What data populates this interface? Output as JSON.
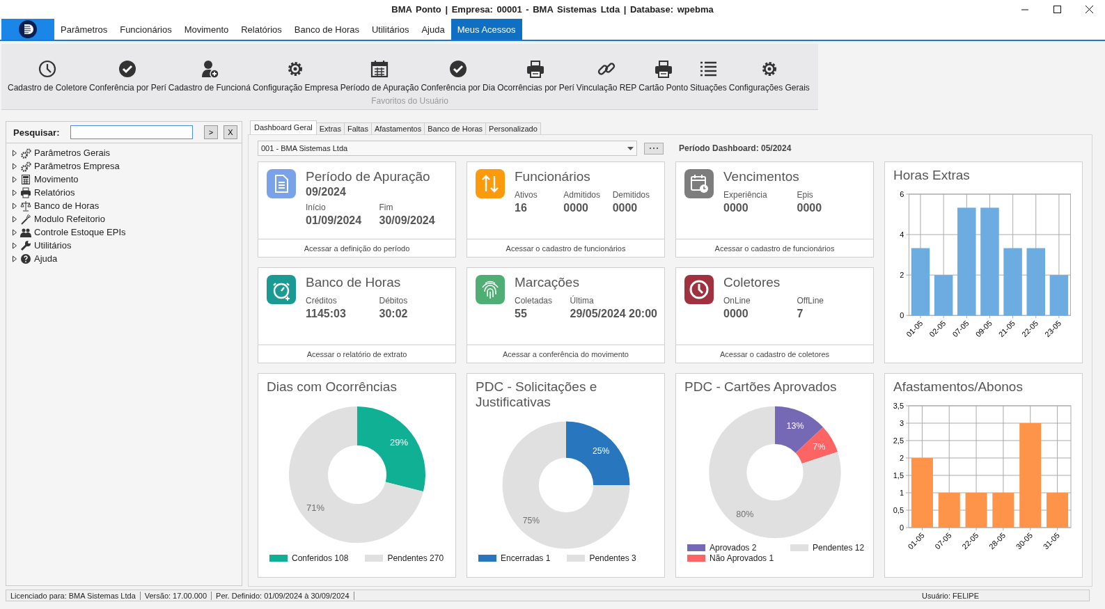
{
  "window": {
    "title": "BMA Ponto | Empresa: 00001 - BMA Sistemas Ltda | Database: wpebma"
  },
  "menu": [
    {
      "label": "Parâmetros",
      "selected": false
    },
    {
      "label": "Funcionários",
      "selected": false
    },
    {
      "label": "Movimento",
      "selected": false
    },
    {
      "label": "Relatórios",
      "selected": false
    },
    {
      "label": "Banco de Horas",
      "selected": false
    },
    {
      "label": "Utilitários",
      "selected": false
    },
    {
      "label": "Ajuda",
      "selected": false
    },
    {
      "label": "Meus Acessos",
      "selected": true
    }
  ],
  "ribbon": {
    "group_label": "Favoritos do Usuário",
    "items": [
      {
        "label": "Cadastro de Coletore",
        "kind": "clock"
      },
      {
        "label": "Conferência por Perí",
        "kind": "check"
      },
      {
        "label": "Cadastro de Funcioná",
        "kind": "user"
      },
      {
        "label": "Configuração Empresa",
        "kind": "gear"
      },
      {
        "label": "Período de Apuração",
        "kind": "calendar"
      },
      {
        "label": "Conferência por Dia",
        "kind": "check"
      },
      {
        "label": "Ocorrências por Perí",
        "kind": "printer"
      },
      {
        "label": "Vinculação REP",
        "kind": "link"
      },
      {
        "label": "Cartão Ponto",
        "kind": "printer"
      },
      {
        "label": "Situações",
        "kind": "list"
      },
      {
        "label": "Configurações Gerais",
        "kind": "gear"
      }
    ]
  },
  "search": {
    "label": "Pesquisar:",
    "buttons": [
      ">",
      "X"
    ]
  },
  "tree": [
    {
      "label": "Parâmetros Gerais",
      "kind": "gears",
      "expanded": false
    },
    {
      "label": "Parâmetros Empresa",
      "kind": "gears",
      "expanded": false
    },
    {
      "label": "Movimento",
      "kind": "calculator",
      "expanded": false
    },
    {
      "label": "Relatórios",
      "kind": "printer",
      "expanded": false
    },
    {
      "label": "Banco de Horas",
      "kind": "scale",
      "expanded": false
    },
    {
      "label": "Modulo Refeitorio",
      "kind": "fork",
      "expanded": false
    },
    {
      "label": "Controle Estoque EPIs",
      "kind": "people",
      "expanded": false
    },
    {
      "label": "Utilitários",
      "kind": "wrench",
      "expanded": false
    },
    {
      "label": "Ajuda",
      "kind": "help",
      "expanded": false
    }
  ],
  "tabs": [
    {
      "label": "Dashboard Geral",
      "selected": true
    },
    {
      "label": "Extras",
      "selected": false
    },
    {
      "label": "Faltas",
      "selected": false
    },
    {
      "label": "Afastamentos",
      "selected": false
    },
    {
      "label": "Banco de Horas",
      "selected": false
    },
    {
      "label": "Personalizado",
      "selected": false
    }
  ],
  "dashboard": {
    "company": "001 - BMA Sistemas Ltda",
    "period": "Período Dashboard: 05/2024",
    "cards": [
      {
        "title": "Período de Apuração",
        "kind": "document",
        "color": "#7aa2e8",
        "headline": "09/2024",
        "fields": [
          {
            "label": "Início",
            "value": "01/09/2024"
          },
          {
            "label": "Fim",
            "value": "30/09/2024"
          }
        ],
        "link": "Acessar a definição do período"
      },
      {
        "title": "Funcionários",
        "kind": "arrows",
        "color": "#fb9a0a",
        "fields": [
          {
            "label": "Ativos",
            "value": "16"
          },
          {
            "label": "Admitidos",
            "value": "0000"
          },
          {
            "label": "Demitidos",
            "value": "0000"
          }
        ],
        "link": "Acessar o cadastro de funcionários"
      },
      {
        "title": "Vencimentos",
        "kind": "calendar",
        "color": "#7d7d7d",
        "fields": [
          {
            "label": "Experiência",
            "value": "0000"
          },
          {
            "label": "Epis",
            "value": "0000"
          }
        ],
        "link": "Acessar o cadastro de funcionários"
      },
      {
        "title": "Banco de Horas",
        "kind": "stopwatch",
        "color": "#1a9a92",
        "fields": [
          {
            "label": "Créditos",
            "value": "1145:03"
          },
          {
            "label": "Débitos",
            "value": "30:02"
          }
        ],
        "link": "Acessar o relatório de extrato"
      },
      {
        "title": "Marcações",
        "kind": "fingerprint",
        "color": "#4fae74",
        "fields": [
          {
            "label": "Coletadas",
            "value": "55"
          },
          {
            "label": "Última",
            "value": "29/05/2024 20:00"
          }
        ],
        "link": "Acessar a conferência do movimento"
      },
      {
        "title": "Coletores",
        "kind": "clock",
        "color": "#a0313f",
        "fields": [
          {
            "label": "OnLine",
            "value": "0000"
          },
          {
            "label": "OffLine",
            "value": "7"
          }
        ],
        "link": "Acessar o cadastro de coletores"
      }
    ],
    "charts": [
      {
        "chart_data": {
          "type": "bar",
          "title": "Horas Extras",
          "categories": [
            "01-05",
            "02-05",
            "07-05",
            "09-05",
            "21-05",
            "22-05",
            "23-05"
          ],
          "series": [
            {
              "color": "#6cace0",
              "values": [
                3.33,
                2,
                5.33,
                5.33,
                3.33,
                3.33,
                2
              ]
            }
          ],
          "grid": true,
          "ylim": [
            0,
            6
          ],
          "yticks": [
            0,
            2,
            4,
            6
          ]
        }
      },
      {
        "chart_data": {
          "type": "donut",
          "title": "Dias com Ocorrências",
          "categories": [
            "Conferidos 108",
            "Pendentes 270"
          ],
          "values": [
            29,
            71
          ],
          "colors": [
            "#10b094",
            "#e0e0e0"
          ],
          "value_labels": [
            "29%",
            "71%"
          ]
        }
      },
      {
        "chart_data": {
          "type": "donut",
          "title": "PDC - Solicitações e Justificativas",
          "categories": [
            "Encerradas 1",
            "Pendentes 3"
          ],
          "values": [
            25,
            75
          ],
          "colors": [
            "#2876be",
            "#e0e0e0"
          ],
          "value_labels": [
            "25%",
            "75%"
          ]
        }
      },
      {
        "chart_data": {
          "type": "donut",
          "title": "PDC - Cartões Aprovados",
          "categories": [
            "Aprovados 2",
            "Não Aprovados 1",
            "Pendentes 12"
          ],
          "values": [
            13,
            7,
            80
          ],
          "colors": [
            "#7569b5",
            "#fd6464",
            "#e0e0e0"
          ],
          "value_labels": [
            "13%",
            "7%",
            "80%"
          ]
        }
      },
      {
        "chart_data": {
          "type": "bar",
          "title": "Afastamentos/Abonos",
          "categories": [
            "01-05",
            "07-05",
            "22-05",
            "28-05",
            "30-05",
            "31-05"
          ],
          "series": [
            {
              "color": "#fd944a",
              "values": [
                2,
                1,
                1,
                1,
                3,
                1
              ]
            }
          ],
          "grid": true,
          "ylim": [
            0,
            3.5
          ],
          "yticks": [
            0,
            {
              "value": 0.5,
              "label": "0,5"
            },
            1,
            {
              "value": 1.5,
              "label": "1,5"
            },
            2,
            {
              "value": 2.5,
              "label": "2,5"
            },
            3,
            {
              "value": 3.5,
              "label": "3,5"
            }
          ]
        }
      }
    ]
  },
  "status_bar": {
    "items": [
      "Licenciado para: BMA Sistemas Ltda",
      "Versão: 17.00.000",
      "Per. Definido: 01/09/2024 à 30/09/2024"
    ],
    "user": "Usuário: FELIPE"
  }
}
